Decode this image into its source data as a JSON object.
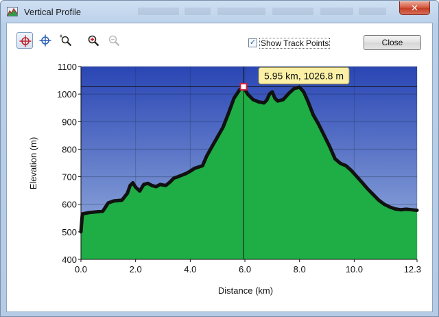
{
  "window": {
    "title": "Vertical Profile",
    "close_glyph": "✕"
  },
  "toolbar": {
    "tools": [
      {
        "name": "crosshair-tool",
        "icon": "crosshair-icon",
        "active": true
      },
      {
        "name": "pan-tool",
        "icon": "move-crosshair-icon",
        "active": false
      },
      {
        "name": "zoom-rect-tool",
        "icon": "zoom-rect-icon",
        "active": false
      },
      {
        "name": "zoom-in-tool",
        "icon": "zoom-in-icon",
        "active": false
      },
      {
        "name": "zoom-out-tool",
        "icon": "zoom-out-icon",
        "active": false,
        "disabled": true
      }
    ],
    "show_track_points": {
      "label": "Show Track Points",
      "checked": true
    },
    "close_label": "Close"
  },
  "colors": {
    "sky_top": "#2a46b4",
    "sky_bottom": "#9cb4e0",
    "fill": "#1fad45",
    "track": "#111111",
    "marker": "#d0203a",
    "tooltip_bg": "#fbf0a6"
  },
  "chart_data": {
    "type": "area",
    "xlabel": "Distance (km)",
    "ylabel": "Elevation (m)",
    "xlim": [
      0,
      12.3
    ],
    "ylim": [
      400,
      1100
    ],
    "x_ticks": [
      "0.0",
      "2.0",
      "4.0",
      "6.0",
      "8.0",
      "10.0",
      "12.3"
    ],
    "y_ticks": [
      "400",
      "500",
      "600",
      "700",
      "800",
      "900",
      "1000",
      "1100"
    ],
    "grid": true,
    "series": [
      {
        "x": [
          0.0,
          0.05,
          0.3,
          0.8,
          1.0,
          1.2,
          1.5,
          1.7,
          1.8,
          1.9,
          2.0,
          2.15,
          2.3,
          2.45,
          2.6,
          2.75,
          2.9,
          3.1,
          3.25,
          3.4,
          3.55,
          3.7,
          3.85,
          4.0,
          4.15,
          4.3,
          4.45,
          4.6,
          4.8,
          5.0,
          5.2,
          5.4,
          5.6,
          5.8,
          5.95,
          6.1,
          6.3,
          6.5,
          6.7,
          6.8,
          6.9,
          7.0,
          7.1,
          7.2,
          7.4,
          7.6,
          7.8,
          8.0,
          8.15,
          8.3,
          8.5,
          8.7,
          8.9,
          9.1,
          9.3,
          9.5,
          9.7,
          9.9,
          10.1,
          10.3,
          10.5,
          10.7,
          10.9,
          11.1,
          11.3,
          11.5,
          11.7,
          11.9,
          12.1,
          12.3
        ],
        "y": [
          500,
          565,
          570,
          575,
          605,
          612,
          615,
          640,
          668,
          678,
          662,
          648,
          672,
          676,
          668,
          664,
          672,
          668,
          680,
          695,
          700,
          706,
          712,
          720,
          730,
          735,
          740,
          775,
          810,
          845,
          880,
          930,
          985,
          1015,
          1026.8,
          1000,
          980,
          972,
          968,
          978,
          1000,
          1008,
          985,
          975,
          980,
          1002,
          1020,
          1025,
          1008,
          975,
          925,
          890,
          850,
          810,
          765,
          748,
          740,
          722,
          700,
          678,
          655,
          635,
          615,
          600,
          590,
          583,
          580,
          582,
          580,
          578
        ]
      }
    ],
    "cursor": {
      "x": 5.95,
      "y": 1026.8,
      "label": "5.95 km, 1026.8 m"
    }
  }
}
